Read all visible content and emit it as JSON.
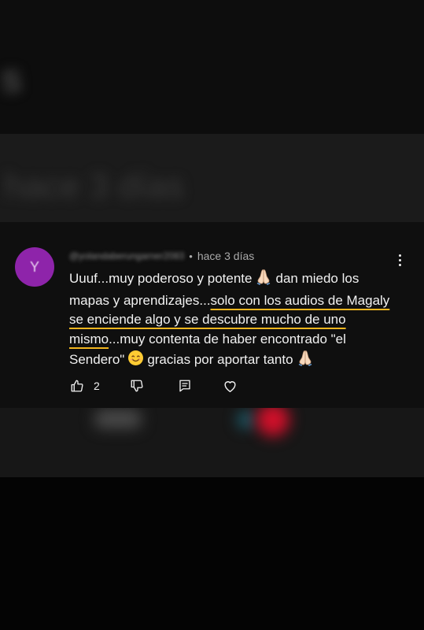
{
  "background": {
    "top_blur_text": "s",
    "band_blur_text": "hace 3 días"
  },
  "comment": {
    "avatar_letter": "Y",
    "username": "@yolandaberungarner2083",
    "separator": "•",
    "timestamp": "hace 3 días",
    "text_part1": "Uuuf...muy poderoso y potente",
    "text_part2": "dan miedo los mapas y aprendizajes...",
    "text_highlight": "solo con los audios de Magaly se enciende algo y se descubre mucho de uno mismo",
    "text_part3": "...muy contenta de haber encontrado \"el Sendero\"",
    "text_part4": "gracias por aportar tanto",
    "likes": "2",
    "colors": {
      "avatar": "#8e24aa",
      "highlight_underline": "#f2b51f",
      "card_background": "#0f0f0f"
    },
    "icons": [
      "pray-emoji",
      "smile-emoji",
      "thumbs-up-icon",
      "thumbs-down-icon",
      "reply-icon",
      "heart-icon",
      "more-vert-icon"
    ]
  }
}
